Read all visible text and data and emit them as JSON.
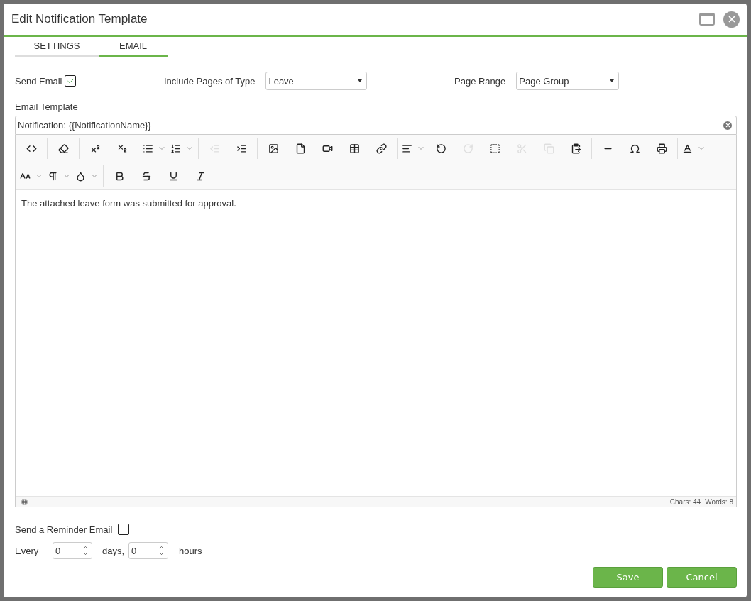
{
  "dialog": {
    "title": "Edit Notification Template"
  },
  "tabs": [
    {
      "label": "SETTINGS",
      "selected": false
    },
    {
      "label": "EMAIL",
      "selected": true
    }
  ],
  "send_email": {
    "label": "Send Email",
    "checked": true
  },
  "page_type": {
    "label": "Include Pages of Type",
    "value": "Leave"
  },
  "page_range": {
    "label": "Page Range",
    "value": "Page Group"
  },
  "email_template": {
    "label": "Email Template",
    "value": "Notification: {{NotificationName}}"
  },
  "toolbar": [
    [
      [
        {
          "kind": "code",
          "dropdown": false,
          "disabled": false
        }
      ],
      [
        {
          "kind": "eraser",
          "dropdown": false,
          "disabled": false
        }
      ],
      [
        {
          "kind": "superscript",
          "dropdown": false,
          "disabled": false
        },
        {
          "kind": "subscript",
          "dropdown": false,
          "disabled": false
        }
      ],
      [
        {
          "kind": "bullets",
          "dropdown": true,
          "disabled": false
        },
        {
          "kind": "numbers",
          "dropdown": true,
          "disabled": false
        }
      ],
      [
        {
          "kind": "outdent",
          "dropdown": false,
          "disabled": true
        },
        {
          "kind": "indent",
          "dropdown": false,
          "disabled": false
        }
      ],
      [
        {
          "kind": "image",
          "dropdown": false,
          "disabled": false
        },
        {
          "kind": "file",
          "dropdown": false,
          "disabled": false
        },
        {
          "kind": "video",
          "dropdown": false,
          "disabled": false
        },
        {
          "kind": "table",
          "dropdown": false,
          "disabled": false
        },
        {
          "kind": "link",
          "dropdown": false,
          "disabled": false
        }
      ],
      [
        {
          "kind": "align",
          "dropdown": true,
          "disabled": false
        },
        {
          "kind": "undo",
          "dropdown": false,
          "disabled": false
        },
        {
          "kind": "redo",
          "dropdown": false,
          "disabled": true
        },
        {
          "kind": "select-all",
          "dropdown": false,
          "disabled": false
        },
        {
          "kind": "cut",
          "dropdown": false,
          "disabled": true
        },
        {
          "kind": "copy",
          "dropdown": false,
          "disabled": true
        },
        {
          "kind": "paste",
          "dropdown": false,
          "disabled": false
        }
      ],
      [
        {
          "kind": "rule",
          "dropdown": false,
          "disabled": false
        },
        {
          "kind": "symbol",
          "dropdown": false,
          "disabled": false
        },
        {
          "kind": "print",
          "dropdown": false,
          "disabled": false
        }
      ],
      [
        {
          "kind": "font",
          "dropdown": true,
          "disabled": false
        }
      ]
    ],
    [
      [
        {
          "kind": "font-size",
          "dropdown": true,
          "disabled": false
        },
        {
          "kind": "paragraph",
          "dropdown": true,
          "disabled": false
        },
        {
          "kind": "color",
          "dropdown": true,
          "disabled": false
        }
      ],
      [
        {
          "kind": "bold",
          "dropdown": false,
          "disabled": false
        },
        {
          "kind": "strike",
          "dropdown": false,
          "disabled": false
        },
        {
          "kind": "underline",
          "dropdown": false,
          "disabled": false
        },
        {
          "kind": "italic",
          "dropdown": false,
          "disabled": false
        }
      ]
    ]
  ],
  "body_text": "The attached leave form was submitted for approval.",
  "status": {
    "chars": "Chars: 44",
    "words": "Words: 8"
  },
  "reminder": {
    "label": "Send a Reminder Email",
    "checked": false,
    "every": "Every",
    "days_value": "0",
    "days": "days,",
    "hours_value": "0",
    "hours": "hours"
  },
  "buttons": [
    {
      "label": "Save"
    },
    {
      "label": "Cancel"
    }
  ]
}
